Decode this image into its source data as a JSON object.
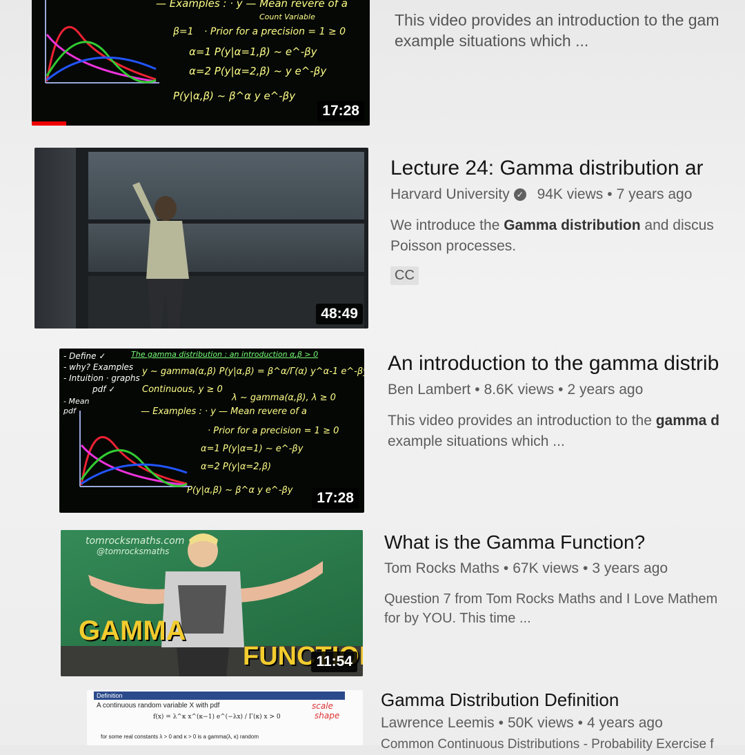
{
  "videos": [
    {
      "duration": "17:28",
      "desc_line1": "This video provides an introduction to the gam",
      "desc_line2": "example situations which ...",
      "board_text": [
        "— Examples : · y — Mean revere of a",
        "Count Variable",
        "· Prior for a precision = 1 ≥ 0",
        "β=1",
        "α=1  P(y|α=1,β) ~ e^-βy",
        "α=2  P(y|α=2,β) ~ y e^-βy",
        "P(y|α,β) ~ β^α y e^-βy"
      ]
    },
    {
      "duration": "48:49",
      "title": "Lecture 24: Gamma distribution ar",
      "channel": "Harvard University",
      "views": "94K views",
      "age": "7 years ago",
      "desc_pre": "We introduce the ",
      "desc_bold": "Gamma distribution",
      "desc_post": " and discus",
      "desc_line2": "Poisson processes.",
      "badge": "CC"
    },
    {
      "duration": "17:28",
      "title": "An introduction to the gamma distrib",
      "channel": "Ben Lambert",
      "views": "8.6K views",
      "age": "2 years ago",
      "desc_pre": "This video provides an introduction to the ",
      "desc_bold": "gamma d",
      "desc_line2": "example situations which ...",
      "board_text": [
        "- Define ✓",
        "- why? Examples",
        "- Intuition · graphs",
        "pdf ✓",
        "- Mean",
        "pdf",
        "The gamma distribution : an introduction  α,β > 0",
        "y ~ gamma(α,β)  P(y|α,β) = β^α/Γ(α) y^α-1 e^-βy",
        "Continuous, y ≥ 0",
        "λ ~ gamma(α,β), λ ≥ 0",
        "— Examples : · y — Mean revere of a",
        "· Prior for a precision = 1 ≥ 0",
        "α=1  P(y|α=1) ~ e^-βy",
        "α=2  P(y|α=2,β)",
        "P(y|α,β) ~ β^α y e^-βy"
      ]
    },
    {
      "duration": "11:54",
      "title": "What is the Gamma Function?",
      "channel": "Tom Rocks Maths",
      "views": "67K views",
      "age": "3 years ago",
      "desc_line1": "Question 7 from Tom Rocks Maths and I Love Mathem",
      "desc_line2": "for by YOU. This time ...",
      "thumb_word1": "GAMMA",
      "thumb_word2": "FUNCTION",
      "thumb_site": "tomrocksmaths.com",
      "thumb_handle": "@tomrocksmaths"
    },
    {
      "title": "Gamma Distribution Definition",
      "channel": "Lawrence Leemis",
      "views": "50K views",
      "age": "4 years ago",
      "desc_line1": "Common Continuous Distributions - Probability Exercise f",
      "thumb_header": "Definition",
      "thumb_line1": "A continuous random variable X with pdf",
      "thumb_formula": "f(x) = λ^κ x^(κ−1) e^(−λx) / Γ(κ)     x > 0",
      "thumb_line2": "for some real constants λ > 0 and κ > 0 is a gamma(λ, κ) random",
      "thumb_note1": "scale",
      "thumb_note2": "shape"
    }
  ]
}
